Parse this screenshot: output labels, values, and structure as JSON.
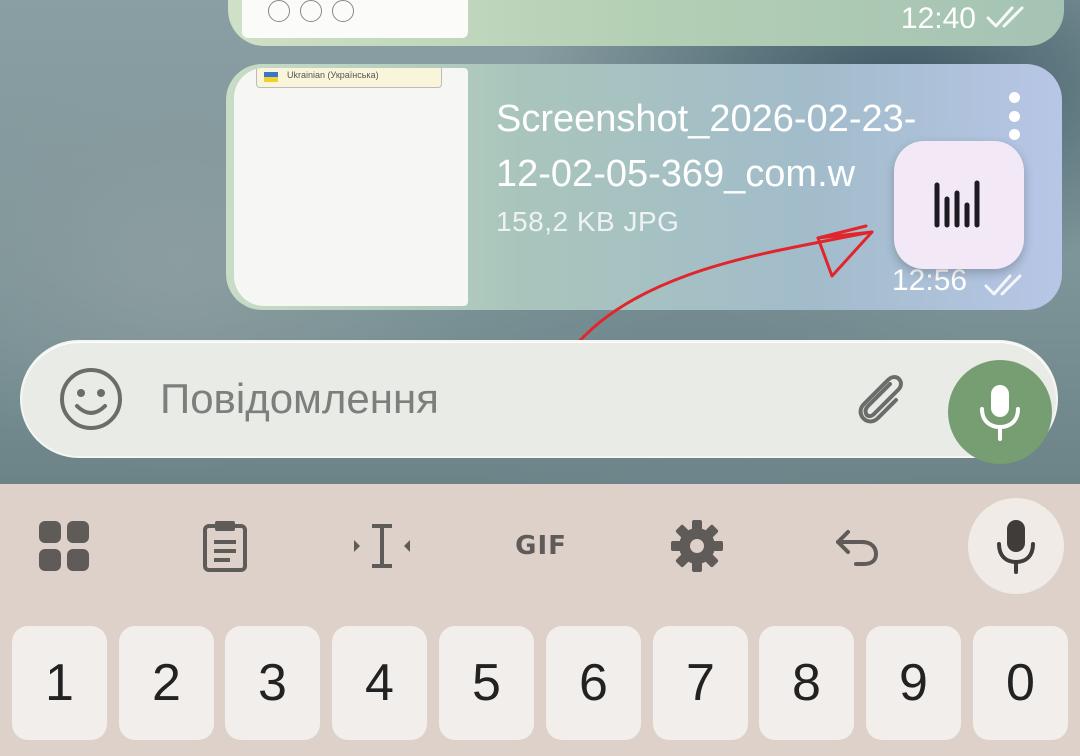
{
  "chat": {
    "previous_message": {
      "time": "12:40",
      "status_icon": "double-check-icon"
    },
    "file_message": {
      "file_name": "Screenshot_2026-02-23-\n12-02-05-369_com.w",
      "file_size_type": "158,2 KB JPG",
      "time": "12:56",
      "status_icon": "double-check-icon",
      "thumbnail_header_text": "Ukrainian (Українська)",
      "menu_icon": "more-vertical-icon"
    },
    "floating_app_icon": "waveform-icon"
  },
  "composer": {
    "placeholder": "Повідомлення",
    "emoji_icon": "smiley-icon",
    "attach_icon": "paperclip-icon",
    "send_icon": "microphone-icon",
    "send_button_color": "#779e72"
  },
  "keyboard": {
    "toolbar": [
      {
        "name": "apps-grid",
        "icon": "grid-icon"
      },
      {
        "name": "clipboard",
        "icon": "clipboard-icon"
      },
      {
        "name": "text-cursor",
        "icon": "text-cursor-icon"
      },
      {
        "name": "gif",
        "label": "GIF"
      },
      {
        "name": "settings",
        "icon": "gear-icon"
      },
      {
        "name": "undo",
        "icon": "undo-icon"
      },
      {
        "name": "voice-input",
        "icon": "microphone-icon"
      }
    ],
    "gif_label": "GIF",
    "number_row": [
      "1",
      "2",
      "3",
      "4",
      "5",
      "6",
      "7",
      "8",
      "9",
      "0"
    ]
  },
  "colors": {
    "annotation_arrow": "#e0262c",
    "keyboard_background": "#ddd1c9",
    "key_background": "#f2eeeb"
  }
}
